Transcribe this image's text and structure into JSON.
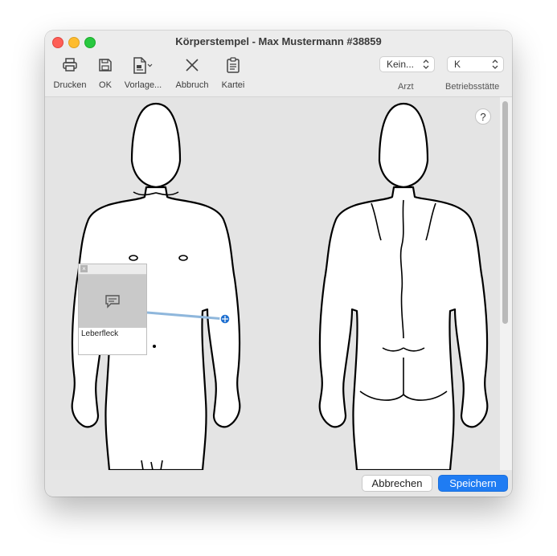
{
  "window": {
    "title": "Körperstempel -  Max Mustermann #38859"
  },
  "toolbar": {
    "print_label": "Drucken",
    "ok_label": "OK",
    "template_label": "Vorlage...",
    "cancel_label": "Abbruch",
    "record_label": "Kartei"
  },
  "doctor_select": {
    "value": "Kein...",
    "label": "Arzt"
  },
  "site_select": {
    "value": "K",
    "label": "Betriebsstätte"
  },
  "help": {
    "label": "?"
  },
  "annotation": {
    "text": "Leberfleck",
    "close_glyph": "×"
  },
  "footer": {
    "cancel_label": "Abbrechen",
    "save_label": "Speichern"
  },
  "icons": {
    "print": "printer-icon",
    "ok": "save-disk-icon",
    "template": "document-template-icon",
    "cancel": "x-icon",
    "record": "clipboard-icon",
    "chevrons": "up-down-chevron-icon",
    "comment": "speech-bubble-icon",
    "marker": "target-marker-icon"
  },
  "colors": {
    "accent": "#1f7cf3",
    "marker": "#1e6fd0",
    "connector": "#8fb7dc"
  }
}
